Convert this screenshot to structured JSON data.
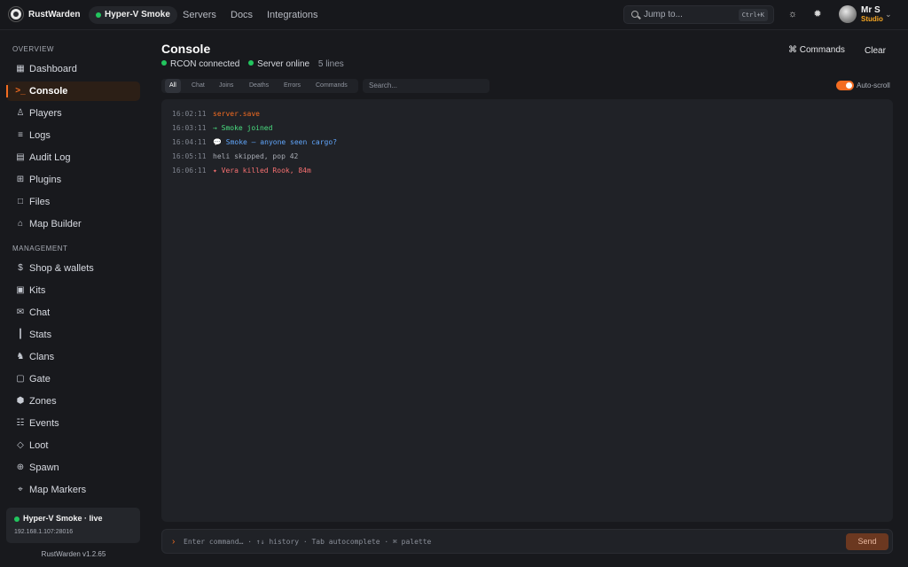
{
  "app": {
    "brand": "RustWarden",
    "server": "Hyper-V Smoke",
    "nav": [
      "Servers",
      "Docs",
      "Integrations"
    ],
    "jump_placeholder": "Jump to...",
    "shortcut": "Ctrl+K",
    "user_name": "Mr S",
    "user_role": "Studio",
    "icons": [
      "logo-icon",
      "search-icon",
      "sun-icon",
      "settings-icon",
      "chevron-down-icon"
    ]
  },
  "sidebar": {
    "overview_heading": "OVERVIEW",
    "overview": [
      {
        "label": "Dashboard",
        "icon": "▦"
      },
      {
        "label": "Console",
        "icon": ">_",
        "active": true
      },
      {
        "label": "Players",
        "icon": "♙"
      },
      {
        "label": "Logs",
        "icon": "≡"
      },
      {
        "label": "Audit Log",
        "icon": "▤"
      },
      {
        "label": "Plugins",
        "icon": "⊞"
      },
      {
        "label": "Files",
        "icon": "□"
      },
      {
        "label": "Map Builder",
        "icon": "⌂"
      }
    ],
    "management_heading": "MANAGEMENT",
    "management": [
      {
        "label": "Shop & wallets",
        "icon": "$"
      },
      {
        "label": "Kits",
        "icon": "▣"
      },
      {
        "label": "Chat",
        "icon": "✉"
      },
      {
        "label": "Stats",
        "icon": "┃"
      },
      {
        "label": "Clans",
        "icon": "♞"
      },
      {
        "label": "Gate",
        "icon": "▢"
      },
      {
        "label": "Zones",
        "icon": "⬢"
      },
      {
        "label": "Events",
        "icon": "☷"
      },
      {
        "label": "Loot",
        "icon": "◇"
      },
      {
        "label": "Spawn",
        "icon": "⊕"
      },
      {
        "label": "Map Markers",
        "icon": "⌖"
      }
    ],
    "live_title": "Hyper-V Smoke · live",
    "live_ip": "192.168.1.107:28016",
    "version": "RustWarden v1.2.65"
  },
  "console": {
    "title": "Console",
    "status_rcon": "RCON connected",
    "status_server": "Server online",
    "lines_count": "5 lines",
    "commands_label": "⌘ Commands",
    "clear_label": "Clear",
    "tabs": [
      "All",
      "Chat",
      "Joins",
      "Deaths",
      "Errors",
      "Commands"
    ],
    "search_placeholder": "Search...",
    "autoscroll_label": "Auto-scroll",
    "autoscroll_on": true,
    "logs": [
      {
        "time": "16:02:11",
        "message": "server.save",
        "color": "#f36c21"
      },
      {
        "time": "16:03:11",
        "message": "→ Smoke joined",
        "color": "#4ade80"
      },
      {
        "time": "16:04:11",
        "message": "💬 Smoke — anyone seen cargo?",
        "color": "#60a5fa"
      },
      {
        "time": "16:05:11",
        "message": "heli skipped, pop 42",
        "color": "#9ca3af"
      },
      {
        "time": "16:06:11",
        "message": "✦ Vera killed Rook, 84m",
        "color": "#f87171"
      }
    ],
    "input_placeholder": "Enter command… · ↑↓ history · Tab autocomplete · ⌘ palette",
    "prompt": "›",
    "send_label": "Send"
  },
  "colors": {
    "accent": "#f36c21",
    "online": "#22c55e"
  }
}
